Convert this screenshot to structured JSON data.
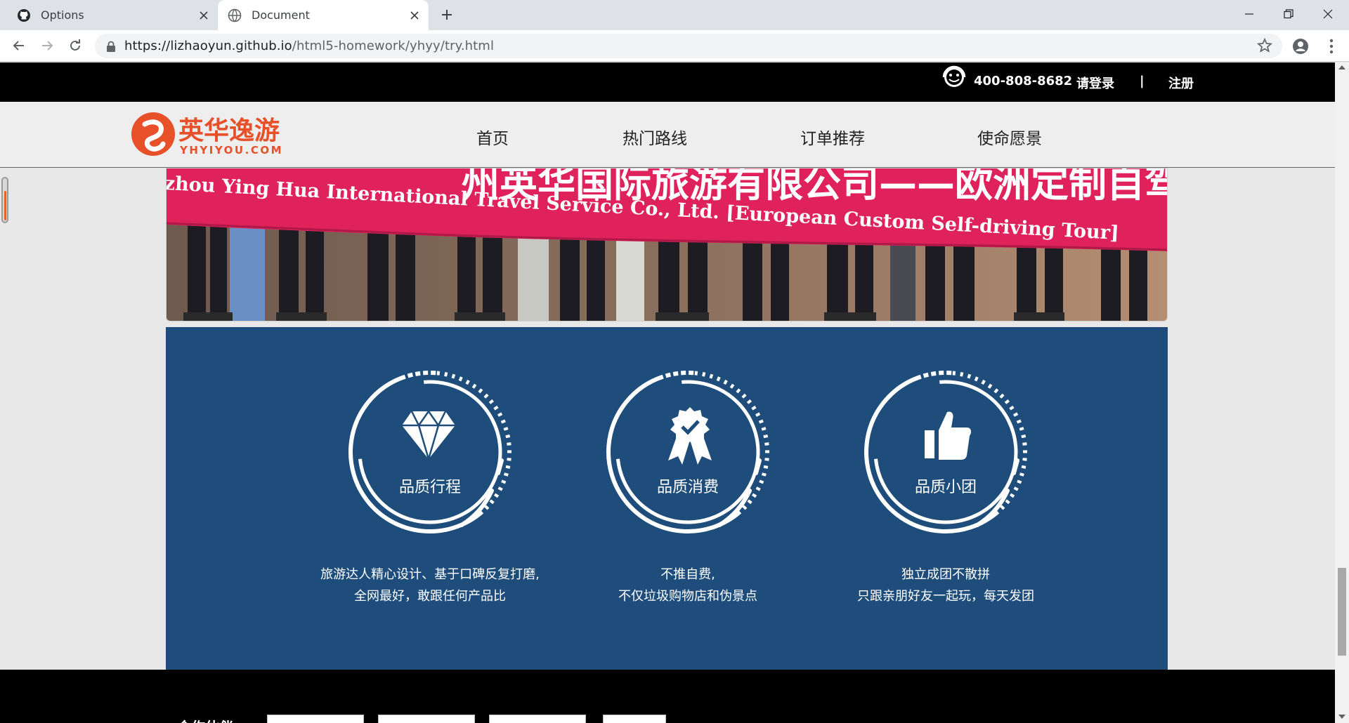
{
  "browser": {
    "tabs": [
      {
        "title": "Options",
        "icon": "github-icon",
        "active": false
      },
      {
        "title": "Document",
        "icon": "globe-icon",
        "active": true
      }
    ],
    "url": {
      "host": "https://lizhaoyun.github.io",
      "path": "/html5-homework/yhyy/try.html"
    }
  },
  "topbar": {
    "phone": "400-808-8682",
    "login": "请登录",
    "separator": "|",
    "register": "注册"
  },
  "logo": {
    "name": "英华逸游",
    "domain": "YHYIYOU.COM",
    "brand_color": "#e8502a"
  },
  "nav": {
    "items": [
      {
        "label": "首页"
      },
      {
        "label": "热门路线"
      },
      {
        "label": "订单推荐"
      },
      {
        "label": "使命愿景"
      }
    ]
  },
  "banner": {
    "title_text": "州英华国际旅游有限公司——欧洲定制自驾游",
    "subtitle_text": "zhou Ying Hua International Travel Service Co., Ltd. [European Custom Self-driving Tour]",
    "banner_color": "#e0225c"
  },
  "features": {
    "bg_color": "#1e4d7b",
    "items": [
      {
        "icon": "diamond-icon",
        "label": "品质行程",
        "desc_line1": "旅游达人精心设计、基于口碑反复打磨,",
        "desc_line2": "全网最好，敢跟任何产品比"
      },
      {
        "icon": "award-ribbon-icon",
        "label": "品质消费",
        "desc_line1": "不推自费,",
        "desc_line2": "不仅垃圾购物店和伪景点"
      },
      {
        "icon": "thumbs-up-icon",
        "label": "品质小团",
        "desc_line1": "独立成团不散拼",
        "desc_line2": "只跟亲朋好友一起玩，每天发团"
      }
    ]
  },
  "footer": {
    "partner_title": "合作伙伴"
  }
}
